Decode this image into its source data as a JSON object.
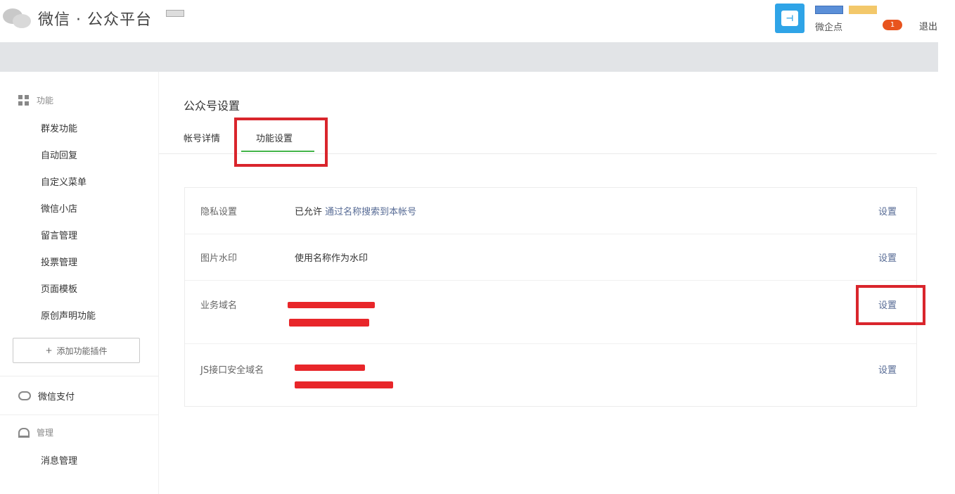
{
  "header": {
    "logo_text": "微信 · 公众平台",
    "account_name": "微企点",
    "notification_count": "1",
    "logout_label": "退出"
  },
  "sidebar": {
    "function_title": "功能",
    "function_items": [
      {
        "label": "群发功能"
      },
      {
        "label": "自动回复"
      },
      {
        "label": "自定义菜单"
      },
      {
        "label": "微信小店"
      },
      {
        "label": "留言管理"
      },
      {
        "label": "投票管理"
      },
      {
        "label": "页面模板"
      },
      {
        "label": "原创声明功能"
      }
    ],
    "add_plugin_label": "添加功能插件",
    "pay_title": "微信支付",
    "manage_title": "管理",
    "manage_items": [
      {
        "label": "消息管理"
      }
    ]
  },
  "main": {
    "page_title": "公众号设置",
    "tabs": [
      {
        "label": "帐号详情"
      },
      {
        "label": "功能设置"
      }
    ],
    "rows": [
      {
        "label": "隐私设置",
        "value_prefix": "已允许 ",
        "value_link": "通过名称搜索到本帐号",
        "action": "设置"
      },
      {
        "label": "图片水印",
        "value_prefix": "使用名称作为水印",
        "value_link": "",
        "action": "设置"
      },
      {
        "label": "业务域名",
        "value_prefix": "",
        "value_link": "",
        "action": "设置"
      },
      {
        "label": "JS接口安全域名",
        "value_prefix": "",
        "value_link": "",
        "action": "设置"
      }
    ]
  },
  "colors": {
    "highlight": "#d9252c",
    "accent_green": "#44b549",
    "link": "#576b95",
    "redaction": "#e8262a"
  }
}
